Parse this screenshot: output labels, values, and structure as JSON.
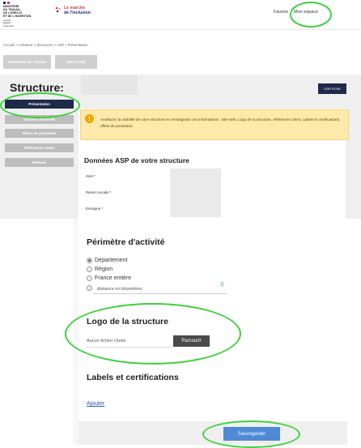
{
  "header": {
    "gov_text": "MINISTÈRE\nDU TRAVAIL,\nDE L'EMPLOI\nET DE L'INSERTION",
    "gov_motto": "Liberté\nÉgalité\nFraternité",
    "brand_line1": "Le marché",
    "brand_line2": "de l'inclusion",
    "nav_favoris": "Favoris",
    "nav_mon_espace": "Mon espace"
  },
  "breadcrumb": "Accueil > Acheteur > Structures > ASP > Présentation",
  "tabs": {
    "demandes": "Demandes de Contact",
    "mon_profil": "Mon Profil"
  },
  "structure": {
    "title": "Structure:",
    "voir_fiche": "VOIR FICHE"
  },
  "sidebar": {
    "items": [
      {
        "label": "Présentation",
        "active": true
      },
      {
        "label": "Secteurs d'activité",
        "active": false
      },
      {
        "label": "Offres de prestation",
        "active": false
      },
      {
        "label": "Références Client",
        "active": false
      },
      {
        "label": "Réseaux",
        "active": false
      }
    ]
  },
  "alert": {
    "text": "Améliorez la visibilité de votre structure en renseignant ces informations : Site web, Logo de la structure, références client, Labels et certifications, offres de prestation."
  },
  "asp_section": {
    "title": "Données ASP de votre structure",
    "fields": [
      {
        "label": "Siret *"
      },
      {
        "label": "Raison sociale *"
      },
      {
        "label": "Enseigne *"
      }
    ]
  },
  "perimetre": {
    "title": "Périmètre d'activité",
    "options": [
      {
        "label": "Département",
        "checked": true
      },
      {
        "label": "Région",
        "checked": false
      },
      {
        "label": "France entière",
        "checked": false
      }
    ],
    "distance_placeholder": "distance en kilomètres"
  },
  "logo": {
    "title": "Logo de la structure",
    "file_status": "Aucun fichier choisi",
    "browse_label": "Parcourir"
  },
  "labels": {
    "title": "Labels et certifications",
    "add_link": "Ajouter"
  },
  "footer": {
    "save_label": "Sauvegarder"
  },
  "colors": {
    "annotation_ring": "#3ed03e",
    "primary_dark": "#1e2a4a",
    "save_blue": "#4e8ad6",
    "alert_bg": "#fde9a9",
    "brand_red": "#d63b50"
  }
}
